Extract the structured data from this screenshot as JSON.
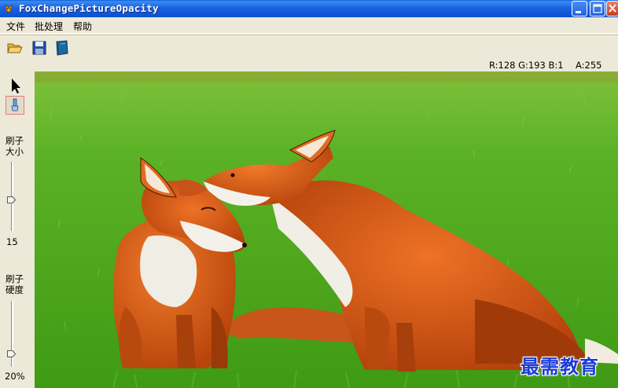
{
  "window": {
    "title": "FoxChangePictureOpacity"
  },
  "menu": {
    "items": [
      "文件",
      "批处理",
      "帮助"
    ]
  },
  "toolbar": {
    "buttons": [
      "open-folder-icon",
      "save-icon",
      "book-icon"
    ]
  },
  "status": {
    "rgb": "R:128 G:193 B:1",
    "alpha": "A:255"
  },
  "left_panel": {
    "tools": [
      "arrow-pointer-icon",
      "brush-icon"
    ],
    "brush_size_label": [
      "刷子",
      "大小"
    ],
    "brush_size_value": "15",
    "brush_hardness_label": [
      "刷子",
      "硬度"
    ],
    "brush_hardness_value": "20%"
  },
  "watermark": "最需教育",
  "colors": {
    "titlebar": "#0b4fcf",
    "chrome": "#ece9d8",
    "grass": "#4fa81c",
    "fox": "#d35a14"
  }
}
